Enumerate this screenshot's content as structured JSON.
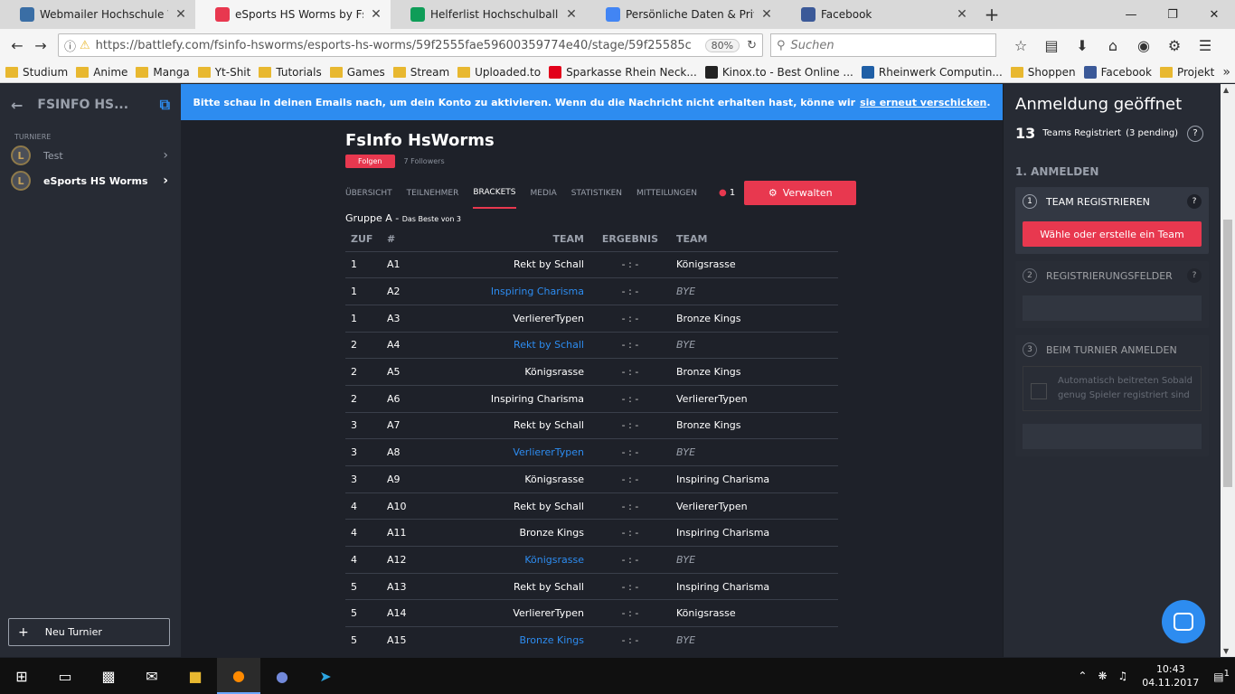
{
  "browser": {
    "tabs": [
      {
        "title": "Webmailer Hochschule Wor",
        "icon": "globe-icon",
        "color": "#3a6ea5"
      },
      {
        "title": "eSports HS Worms by FsInfo",
        "icon": "battlefy-icon",
        "color": "#e8384f",
        "active": true
      },
      {
        "title": "Helferlist Hochschulball Vor",
        "icon": "sheets-icon",
        "color": "#0f9d58"
      },
      {
        "title": "Persönliche Daten & Privatsp",
        "icon": "google-icon",
        "color": "#4285f4"
      },
      {
        "title": "Facebook",
        "icon": "facebook-icon",
        "color": "#3b5998"
      }
    ],
    "url": "https://battlefy.com/fsinfo-hsworms/esports-hs-worms/59f2555fae59600359774e40/stage/59f25585c",
    "zoom": "80%",
    "search_placeholder": "Suchen",
    "bookmarks": [
      {
        "label": "Studium",
        "type": "folder"
      },
      {
        "label": "Anime",
        "type": "folder"
      },
      {
        "label": "Manga",
        "type": "folder"
      },
      {
        "label": "Yt-Shit",
        "type": "folder"
      },
      {
        "label": "Tutorials",
        "type": "folder"
      },
      {
        "label": "Games",
        "type": "folder"
      },
      {
        "label": "Stream",
        "type": "folder"
      },
      {
        "label": "Uploaded.to",
        "type": "folder"
      },
      {
        "label": "Sparkasse Rhein Neck...",
        "type": "site",
        "color": "#e2001a"
      },
      {
        "label": "Kinox.to - Best Online ...",
        "type": "site",
        "color": "#222"
      },
      {
        "label": "Rheinwerk Computin...",
        "type": "site",
        "color": "#1f5fa6"
      },
      {
        "label": "Shoppen",
        "type": "folder"
      },
      {
        "label": "Facebook",
        "type": "site",
        "color": "#3b5998"
      },
      {
        "label": "Projekt",
        "type": "folder"
      }
    ]
  },
  "sidebar": {
    "org_name": "FSINFO HS...",
    "section_label": "TURNIERE",
    "items": [
      {
        "label": "Test",
        "active": false
      },
      {
        "label": "eSports HS Worms",
        "active": true
      }
    ],
    "new_button": "Neu Turnier"
  },
  "banner": {
    "text": "Bitte schau in deinen Emails nach, um dein Konto zu aktivieren. Wenn du die Nachricht nicht erhalten hast, könne wir",
    "link": "sie erneut verschicken",
    "suffix": "."
  },
  "tournament": {
    "title": "FsInfo HsWorms",
    "follow_label": "Folgen",
    "followers": "7 Followers",
    "tabs": [
      "ÜBERSICHT",
      "TEILNEHMER",
      "BRACKETS",
      "MEDIA",
      "STATISTIKEN",
      "MITTEILUNGEN"
    ],
    "active_tab": "BRACKETS",
    "participants_count": "1",
    "manage_label": "Verwalten",
    "group_label": "Gruppe A - ",
    "group_sub": "Das Beste von 3",
    "columns": [
      "ZUF",
      "#",
      "TEAM",
      "ERGEBNIS",
      "TEAM"
    ],
    "matches": [
      {
        "round": "1",
        "id": "A1",
        "team1": "Rekt by Schall",
        "score": "- : -",
        "team2": "Königsrasse",
        "winner": false
      },
      {
        "round": "1",
        "id": "A2",
        "team1": "Inspiring Charisma",
        "score": "- : -",
        "team2": "BYE",
        "winner": true
      },
      {
        "round": "1",
        "id": "A3",
        "team1": "VerliererTypen",
        "score": "- : -",
        "team2": "Bronze Kings",
        "winner": false
      },
      {
        "round": "2",
        "id": "A4",
        "team1": "Rekt by Schall",
        "score": "- : -",
        "team2": "BYE",
        "winner": true
      },
      {
        "round": "2",
        "id": "A5",
        "team1": "Königsrasse",
        "score": "- : -",
        "team2": "Bronze Kings",
        "winner": false
      },
      {
        "round": "2",
        "id": "A6",
        "team1": "Inspiring Charisma",
        "score": "- : -",
        "team2": "VerliererTypen",
        "winner": false
      },
      {
        "round": "3",
        "id": "A7",
        "team1": "Rekt by Schall",
        "score": "- : -",
        "team2": "Bronze Kings",
        "winner": false
      },
      {
        "round": "3",
        "id": "A8",
        "team1": "VerliererTypen",
        "score": "- : -",
        "team2": "BYE",
        "winner": true
      },
      {
        "round": "3",
        "id": "A9",
        "team1": "Königsrasse",
        "score": "- : -",
        "team2": "Inspiring Charisma",
        "winner": false
      },
      {
        "round": "4",
        "id": "A10",
        "team1": "Rekt by Schall",
        "score": "- : -",
        "team2": "VerliererTypen",
        "winner": false
      },
      {
        "round": "4",
        "id": "A11",
        "team1": "Bronze Kings",
        "score": "- : -",
        "team2": "Inspiring Charisma",
        "winner": false
      },
      {
        "round": "4",
        "id": "A12",
        "team1": "Königsrasse",
        "score": "- : -",
        "team2": "BYE",
        "winner": true
      },
      {
        "round": "5",
        "id": "A13",
        "team1": "Rekt by Schall",
        "score": "- : -",
        "team2": "Inspiring Charisma",
        "winner": false
      },
      {
        "round": "5",
        "id": "A14",
        "team1": "VerliererTypen",
        "score": "- : -",
        "team2": "Königsrasse",
        "winner": false
      },
      {
        "round": "5",
        "id": "A15",
        "team1": "Bronze Kings",
        "score": "- : -",
        "team2": "BYE",
        "winner": true
      }
    ]
  },
  "registration": {
    "title": "Anmeldung geöffnet",
    "count": "13",
    "count_label": "Teams Registriert",
    "pending": "(3 pending)",
    "step_heading": "1. ANMELDEN",
    "card1_num": "1",
    "card1_title": "TEAM REGISTRIEREN",
    "card1_button": "Wähle oder erstelle ein Team",
    "card2_num": "2",
    "card2_title": "REGISTRIERUNGSFELDER",
    "card3_num": "3",
    "card3_title": "BEIM TURNIER ANMELDEN",
    "auto_join": "Automatisch beitreten Sobald genug Spieler registriert sind"
  },
  "taskbar": {
    "time": "10:43",
    "date": "04.11.2017",
    "notifications": "1"
  },
  "colors": {
    "accent": "#e8384f",
    "link": "#2d8cf0",
    "banner": "#2d8cf0"
  }
}
